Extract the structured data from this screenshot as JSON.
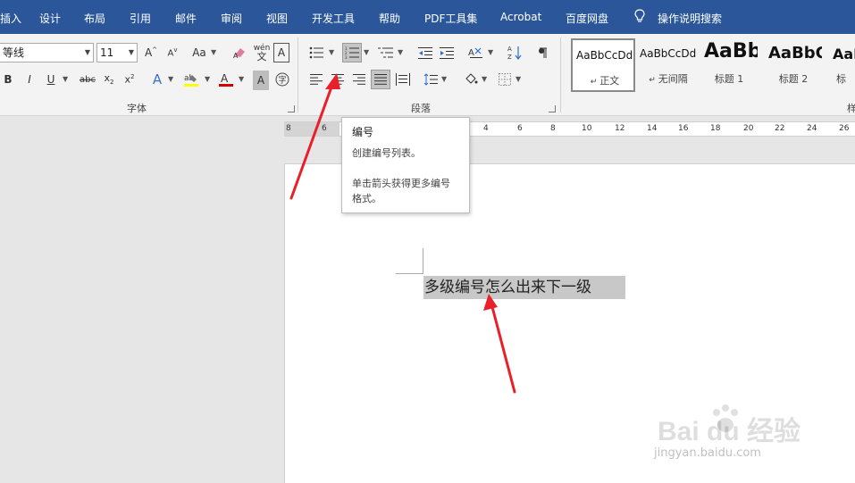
{
  "menu": {
    "tabs": [
      "插入",
      "设计",
      "布局",
      "引用",
      "邮件",
      "审阅",
      "视图",
      "开发工具",
      "帮助",
      "PDF工具集",
      "Acrobat",
      "百度网盘"
    ],
    "tell_me": "操作说明搜索"
  },
  "ribbon": {
    "font_name": "等线",
    "font_size": "11",
    "font_group_label": "字体",
    "paragraph_group_label": "段落",
    "styles_group_label_fragment": "样",
    "phonetic_guide_label": "wén",
    "styles": [
      {
        "sample": "AaBbCcDd",
        "name": "正文",
        "selected": true
      },
      {
        "sample": "AaBbCcDd",
        "name": "无间隔",
        "selected": false
      },
      {
        "sample": "AaBb",
        "name": "标题 1",
        "selected": false
      },
      {
        "sample": "AaBbC",
        "name": "标题 2",
        "selected": false
      },
      {
        "sample": "AaB",
        "name": "标",
        "selected": false
      }
    ]
  },
  "ruler": {
    "ticks": [
      "8",
      "6",
      "4",
      "6",
      "8",
      "10",
      "12",
      "14",
      "16",
      "18",
      "20",
      "22",
      "24",
      "26"
    ]
  },
  "tooltip": {
    "title": "编号",
    "line1": "创建编号列表。",
    "line2": "单击箭头获得更多编号",
    "line3": "格式。"
  },
  "document": {
    "text": "多级编号怎么出来下一级"
  },
  "watermark": {
    "main": "Bai du 经验",
    "sub": "jingyan.baidu.com"
  },
  "colors": {
    "menubar": "#2b579a",
    "annotation_arrow": "#e8202a",
    "selection": "#c8c8c8"
  }
}
